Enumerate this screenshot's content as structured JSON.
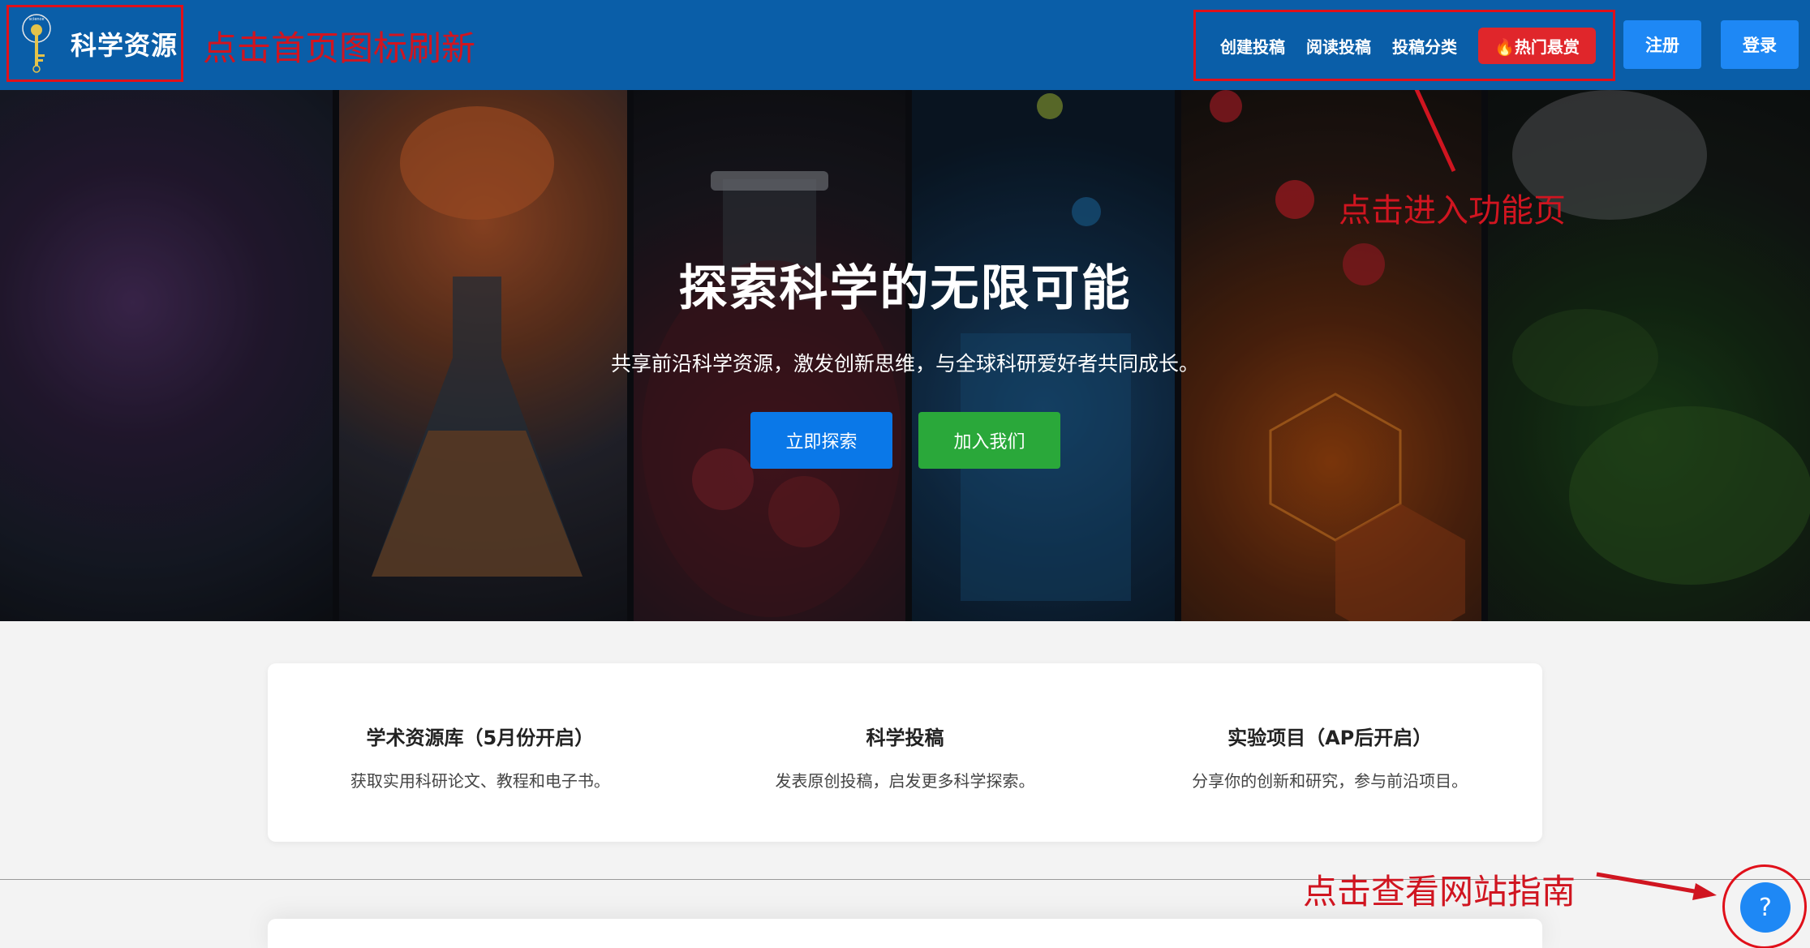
{
  "header": {
    "logo_text": "科学资源",
    "logo_icon": "science-key-icon",
    "annotation_refresh": "点击首页图标刷新",
    "nav": {
      "create": "创建投稿",
      "read": "阅读投稿",
      "categories": "投稿分类",
      "hot_bounty": "🔥热门悬赏"
    },
    "register": "注册",
    "login": "登录"
  },
  "hero": {
    "title": "探索科学的无限可能",
    "subtitle": "共享前沿科学资源，激发创新思维，与全球科研爱好者共同成长。",
    "explore_button": "立即探索",
    "join_button": "加入我们",
    "annotation_function": "点击进入功能页"
  },
  "features": [
    {
      "title": "学术资源库（5月份开启）",
      "desc": "获取实用科研论文、教程和电子书。"
    },
    {
      "title": "科学投稿",
      "desc": "发表原创投稿，启发更多科学探索。"
    },
    {
      "title": "实验项目（AP后开启）",
      "desc": "分享你的创新和研究，参与前沿项目。"
    }
  ],
  "help": {
    "annotation_guide": "点击查看网站指南",
    "button_label": "?"
  },
  "colors": {
    "header_bg": "#0a5ea8",
    "annotation_red": "#d01520",
    "primary_blue": "#1e88f5",
    "join_green": "#2aa83a",
    "hot_red": "#e0262b"
  }
}
